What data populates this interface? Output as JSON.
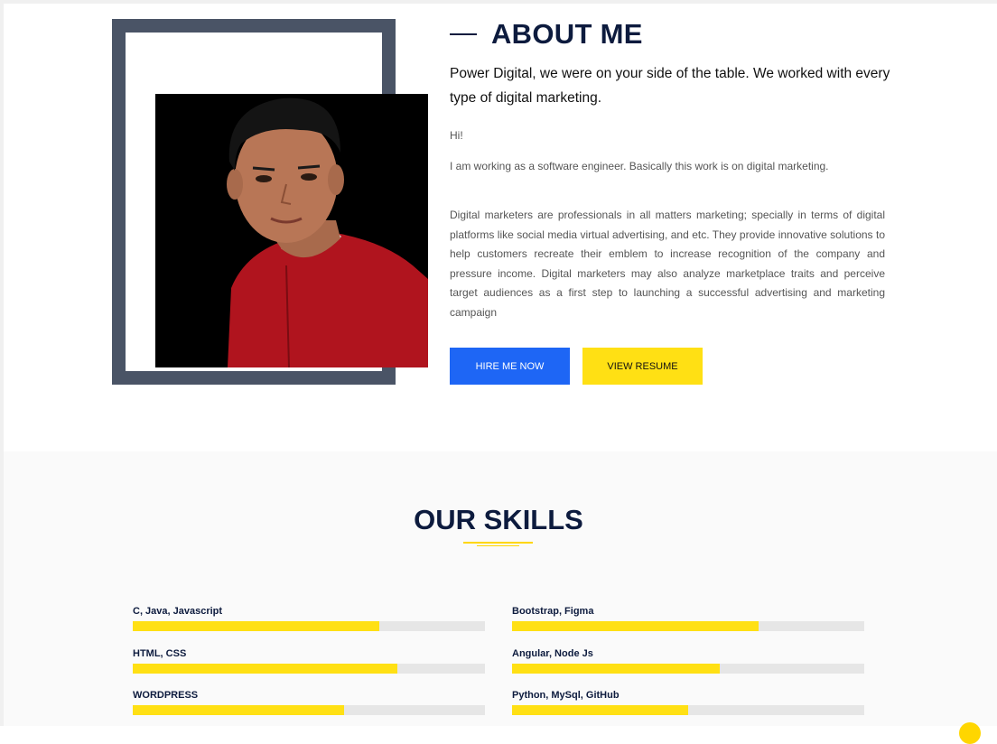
{
  "about": {
    "title": "ABOUT ME",
    "lead": "Power Digital, we were on your side of the table. We worked with every type of digital marketing.",
    "greeting": "Hi!",
    "intro": "I am working as a software engineer. Basically this work is on digital marketing.",
    "description": "Digital marketers are professionals in all matters marketing; specially in terms of digital platforms like social media virtual advertising, and etc. They provide innovative solutions to help customers recreate their emblem to increase recognition of the company and pressure income. Digital marketers may also analyze marketplace traits and perceive target audiences as a first step to launching a successful advertising and marketing campaign",
    "hire_label": "HIRE ME NOW",
    "resume_label": "VIEW RESUME"
  },
  "skills": {
    "title": "OUR SKILLS",
    "items": [
      {
        "label": "C, Java, Javascript",
        "percent": 70
      },
      {
        "label": "Bootstrap, Figma",
        "percent": 70
      },
      {
        "label": "HTML, CSS",
        "percent": 75
      },
      {
        "label": "Angular, Node Js",
        "percent": 59
      },
      {
        "label": "WORDPRESS",
        "percent": 60
      },
      {
        "label": "Python, MySql, GitHub",
        "percent": 50
      }
    ]
  },
  "colors": {
    "accent_yellow": "#ffe014",
    "accent_blue": "#1e66f5",
    "heading_navy": "#0d1b3e",
    "frame_gray": "#4a5466"
  }
}
